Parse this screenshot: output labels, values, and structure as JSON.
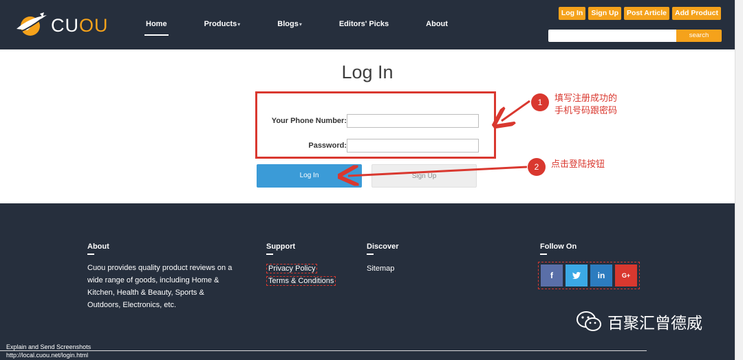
{
  "header": {
    "logo": {
      "part1": "CU",
      "part2": "OU"
    },
    "nav": [
      {
        "label": "Home",
        "active": true,
        "caret": ""
      },
      {
        "label": "Products",
        "active": false,
        "caret": "▾"
      },
      {
        "label": "Blogs",
        "active": false,
        "caret": "▾"
      },
      {
        "label": "Editors' Picks",
        "active": false,
        "caret": ""
      },
      {
        "label": "About",
        "active": false,
        "caret": ""
      }
    ],
    "buttons": {
      "login": "Log In",
      "signup": "Sign Up",
      "post_article": "Post Article",
      "add_product": "Add Product"
    },
    "search": {
      "placeholder": "",
      "button": "search"
    }
  },
  "main": {
    "title": "Log In",
    "phone_label": "Your Phone Number:",
    "password_label": "Password:",
    "login_button": "Log In",
    "signup_button": "Sign Up"
  },
  "annotations": {
    "step1": {
      "num": "1",
      "line1": "填写注册成功的",
      "line2": "手机号码跟密码"
    },
    "step2": {
      "num": "2",
      "text": "点击登陆按钮"
    }
  },
  "footer": {
    "about": {
      "heading": "About",
      "text": "Cuou provides quality product reviews on a wide range of goods, including Home & Kitchen, Health & Beauty, Sports & Outdoors, Electronics, etc."
    },
    "support": {
      "heading": "Support",
      "links": [
        "Privacy Policy",
        "Terms & Conditions"
      ]
    },
    "discover": {
      "heading": "Discover",
      "links": [
        "Sitemap"
      ]
    },
    "follow": {
      "heading": "Follow On",
      "icons": [
        "f",
        "t",
        "in",
        "G+"
      ]
    },
    "watermark": "百聚汇曾德威"
  },
  "status": {
    "line1": "Explain and Send Screenshots",
    "line2": "http://local.cuou.net/login.html"
  },
  "colors": {
    "header_bg": "#262f3d",
    "accent": "#f5a21b",
    "annotation": "#d9382f",
    "login_button": "#3b9bd7"
  }
}
